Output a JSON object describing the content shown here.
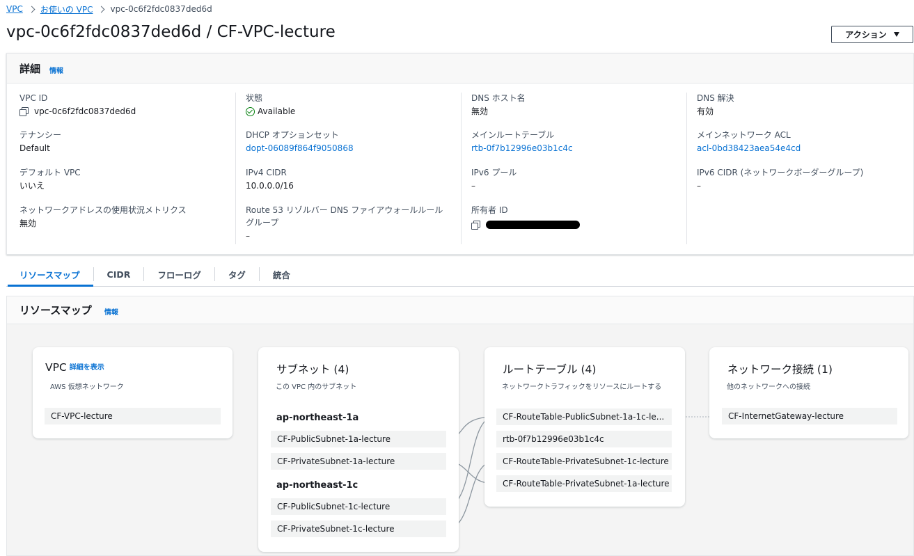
{
  "breadcrumb": {
    "items": [
      "VPC",
      "お使いの VPC"
    ],
    "current": "vpc-0c6f2fdc0837ded6d"
  },
  "page_title": "vpc-0c6f2fdc0837ded6d / CF-VPC-lecture",
  "action_button": "アクション",
  "details": {
    "title": "詳細",
    "info": "情報",
    "fields": {
      "vpc_id": {
        "label": "VPC ID",
        "value": "vpc-0c6f2fdc0837ded6d"
      },
      "state": {
        "label": "状態",
        "value": "Available"
      },
      "dns_hostnames": {
        "label": "DNS ホスト名",
        "value": "無効"
      },
      "dns_resolution": {
        "label": "DNS 解決",
        "value": "有効"
      },
      "tenancy": {
        "label": "テナンシー",
        "value": "Default"
      },
      "dhcp_options": {
        "label": "DHCP オプションセット",
        "value": "dopt-06089f864f9050868"
      },
      "main_route_table": {
        "label": "メインルートテーブル",
        "value": "rtb-0f7b12996e03b1c4c"
      },
      "main_acl": {
        "label": "メインネットワーク ACL",
        "value": "acl-0bd38423aea54e4cd"
      },
      "default_vpc": {
        "label": "デフォルト VPC",
        "value": "いいえ"
      },
      "ipv4_cidr": {
        "label": "IPv4 CIDR",
        "value": "10.0.0.0/16"
      },
      "ipv6_pool": {
        "label": "IPv6 プール",
        "value": "–"
      },
      "ipv6_cidr": {
        "label": "IPv6 CIDR (ネットワークボーダーグループ)",
        "value": "–"
      },
      "address_metrics": {
        "label": "ネットワークアドレスの使用状況メトリクス",
        "value": "無効"
      },
      "route53": {
        "label_line1": "Route 53 リゾルバー DNS ファイアウォールルール",
        "label_line2": "グループ",
        "value": "–"
      },
      "owner_id": {
        "label": "所有者 ID"
      }
    }
  },
  "tabs": [
    "リソースマップ",
    "CIDR",
    "フローログ",
    "タグ",
    "統合"
  ],
  "resource_map": {
    "title": "リソースマップ",
    "info": "情報",
    "vpc_card": {
      "title": "VPC",
      "link": "詳細を表示",
      "subtitle": "AWS 仮想ネットワーク",
      "items": [
        "CF-VPC-lecture"
      ]
    },
    "subnet_card": {
      "title": "サブネット (4)",
      "subtitle": "この VPC 内のサブネット",
      "groups": [
        {
          "az": "ap-northeast-1a",
          "items": [
            "CF-PublicSubnet-1a-lecture",
            "CF-PrivateSubnet-1a-lecture"
          ]
        },
        {
          "az": "ap-northeast-1c",
          "items": [
            "CF-PublicSubnet-1c-lecture",
            "CF-PrivateSubnet-1c-lecture"
          ]
        }
      ]
    },
    "route_card": {
      "title": "ルートテーブル (4)",
      "subtitle": "ネットワークトラフィックをリソースにルートする",
      "items": [
        "CF-RouteTable-PublicSubnet-1a-1c-le...",
        "rtb-0f7b12996e03b1c4c",
        "CF-RouteTable-PrivateSubnet-1c-lecture",
        "CF-RouteTable-PrivateSubnet-1a-lecture"
      ]
    },
    "network_card": {
      "title": "ネットワーク接続 (1)",
      "subtitle": "他のネットワークへの接続",
      "items": [
        "CF-InternetGateway-lecture"
      ]
    }
  }
}
